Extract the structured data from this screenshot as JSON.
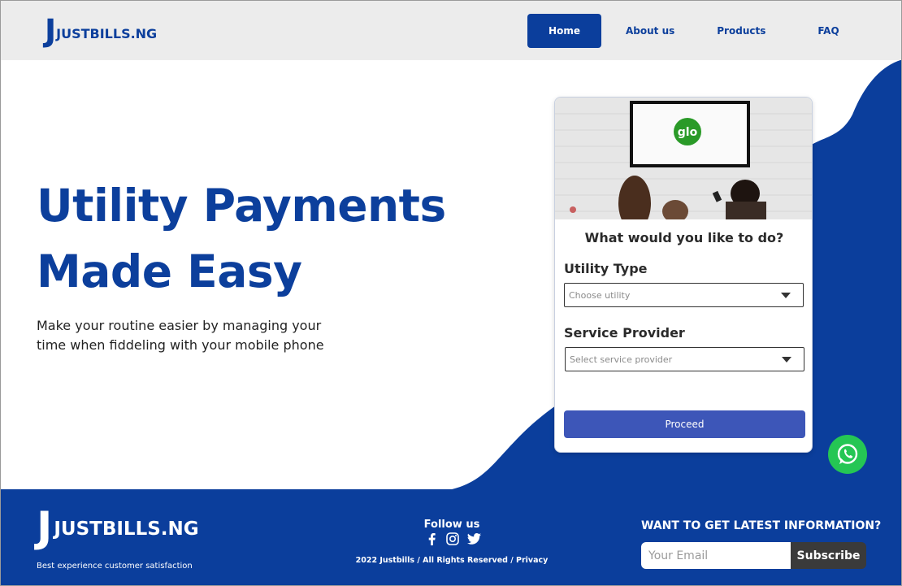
{
  "header": {
    "logo_j": "J",
    "logo_text": "JUSTBILLS.NG",
    "nav": [
      {
        "label": "Home",
        "active": true
      },
      {
        "label": "About us"
      },
      {
        "label": "Products"
      },
      {
        "label": "FAQ"
      }
    ]
  },
  "hero": {
    "title_line1": "Utility Payments",
    "title_line2": "Made Easy",
    "subtitle": "Make your routine easier by managing your time when fiddeling with your mobile phone"
  },
  "card": {
    "image_logo_text": "glo",
    "question": "What would you like to do?",
    "utility_label": "Utility Type",
    "utility_placeholder": "Choose utility",
    "provider_label": "Service Provider",
    "provider_placeholder": "Select service provider",
    "proceed_label": "Proceed"
  },
  "footer": {
    "logo_j": "J",
    "logo_text": "JUSTBILLS.NG",
    "tagline": "Best experience customer  satisfaction",
    "follow_label": "Follow us",
    "social_icons": [
      "facebook-icon",
      "instagram-icon",
      "twitter-icon"
    ],
    "copyright": "2022 Justbills / All Rights Reserved / Privacy",
    "newsletter_title": "WANT TO GET LATEST INFORMATION?",
    "email_placeholder": "Your Email",
    "subscribe_label": "Subscribe"
  },
  "colors": {
    "brand_blue": "#0b3e9c",
    "button_blue": "#3d56b8",
    "whatsapp_green": "#25c654",
    "header_bg": "#ececec"
  }
}
